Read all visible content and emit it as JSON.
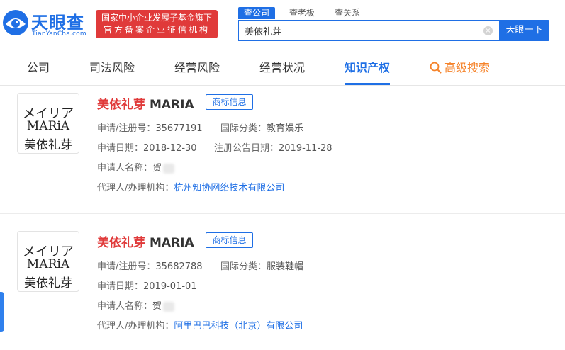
{
  "header": {
    "logo_cn": "天眼查",
    "logo_en": "TianYanCha.com",
    "badge_line1": "国家中小企业发展子基金旗下",
    "badge_line2": "官方备案企业征信机构",
    "search_tabs": [
      "查公司",
      "查老板",
      "查关系"
    ],
    "search_value": "美依礼芽",
    "search_button": "天眼一下"
  },
  "nav": {
    "items": [
      "公司",
      "司法风险",
      "经营风险",
      "经营状况",
      "知识产权"
    ],
    "active_index": 4,
    "advanced_search": "高级搜索"
  },
  "cards": [
    {
      "image_lines": [
        "メイリア",
        "MARiA",
        "美依礼芽"
      ],
      "title_cn": "美依礼芽",
      "title_en": "MARIA",
      "badge": "商标信息",
      "reg_label": "申请/注册号：",
      "reg_value": "35677191",
      "class_label": "国际分类：",
      "class_value": "教育娱乐",
      "apply_label": "申请日期：",
      "apply_value": "2018-12-30",
      "notice_label": "注册公告日期：",
      "notice_value": "2019-11-28",
      "applicant_label": "申请人名称：",
      "applicant_value": "贺",
      "agent_label": "代理人/办理机构：",
      "agent_value": "杭州知协网络技术有限公司"
    },
    {
      "image_lines": [
        "メイリア",
        "MARiA",
        "美依礼芽"
      ],
      "title_cn": "美依礼芽",
      "title_en": "MARIA",
      "badge": "商标信息",
      "reg_label": "申请/注册号：",
      "reg_value": "35682788",
      "class_label": "国际分类：",
      "class_value": "服装鞋帽",
      "apply_label": "申请日期：",
      "apply_value": "2019-01-01",
      "applicant_label": "申请人名称：",
      "applicant_value": "贺",
      "agent_label": "代理人/办理机构：",
      "agent_value": "阿里巴巴科技（北京）有限公司"
    }
  ],
  "colors": {
    "brand_blue": "#1f6fe5",
    "brand_red": "#e03a3a",
    "advanced_orange": "#f5832a"
  }
}
